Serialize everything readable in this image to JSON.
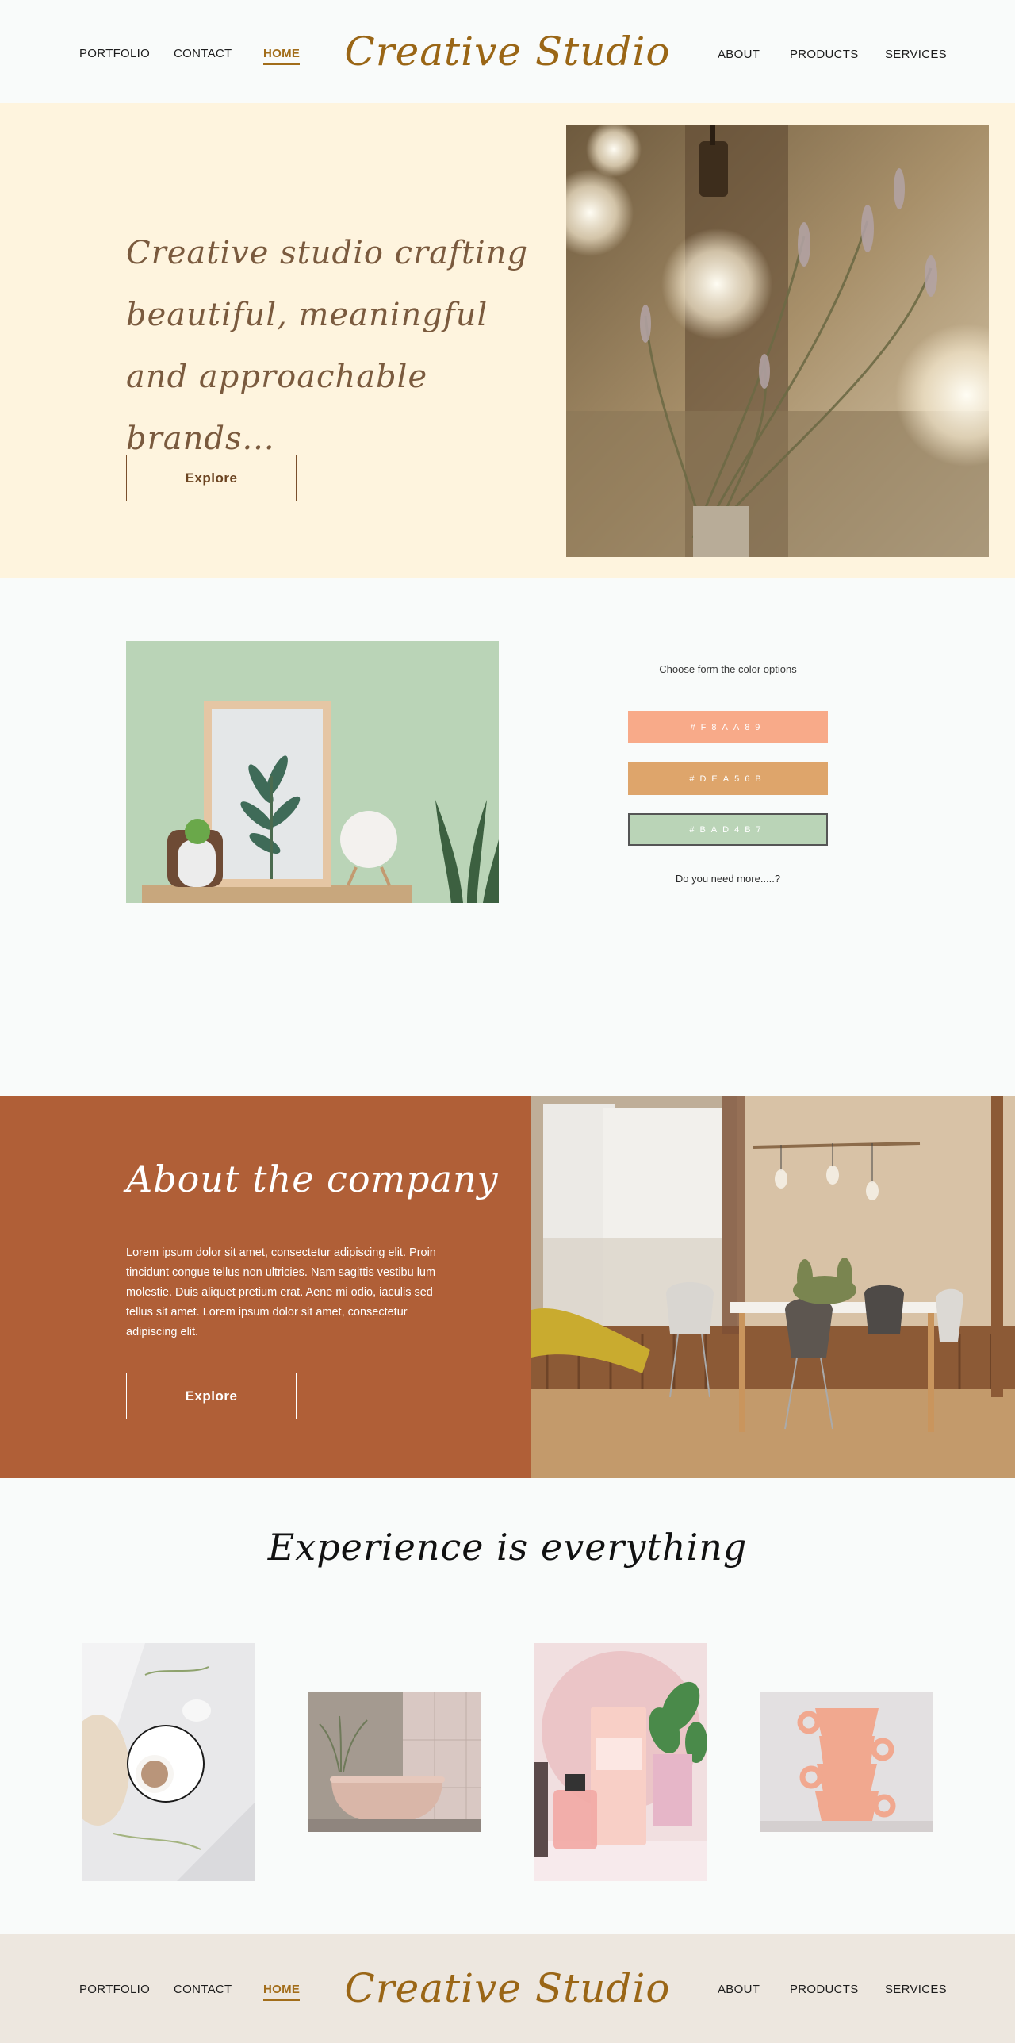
{
  "brand": {
    "name": "Creative Studio",
    "color": "#9a6616"
  },
  "nav": {
    "left": [
      {
        "label": "PORTFOLIO"
      },
      {
        "label": "CONTACT"
      },
      {
        "label": "HOME",
        "active": true
      }
    ],
    "right": [
      {
        "label": "ABOUT"
      },
      {
        "label": "PRODUCTS"
      },
      {
        "label": "SERVICES"
      }
    ]
  },
  "hero": {
    "title": "Creative studio crafting beautiful, meaningful and approachable brands...",
    "button_label": "Explore",
    "background": "#fef4de"
  },
  "color_options": {
    "label": "Choose form the color options",
    "swatches": [
      {
        "hex": "#F8AA89",
        "label": "#F8AA89"
      },
      {
        "hex": "#DEA56B",
        "label": "#DEA56B"
      },
      {
        "hex": "#BAD4B7",
        "label": "#BAD4B7",
        "selected": true
      }
    ],
    "more_label": "Do you need more.....?"
  },
  "about": {
    "title": "About the company",
    "text": "Lorem ipsum dolor sit amet, consectetur adipiscing elit. Proin tincidunt congue tellus non ultricies. Nam sagittis vestibu lum molestie. Duis aliquet pretium erat. Aene mi odio, iaculis sed tellus sit amet. Lorem ipsum dolor sit amet, consectetur adipiscing elit.",
    "button_label": "Explore",
    "background": "#b05f37"
  },
  "experience": {
    "title": "Experience is everything",
    "gallery": [
      {
        "icon": "coffee-flatlay-image"
      },
      {
        "icon": "bathtub-image"
      },
      {
        "icon": "cosmetics-image"
      },
      {
        "icon": "stacked-cups-image"
      }
    ]
  },
  "footer": {
    "background": "#ede7df"
  }
}
